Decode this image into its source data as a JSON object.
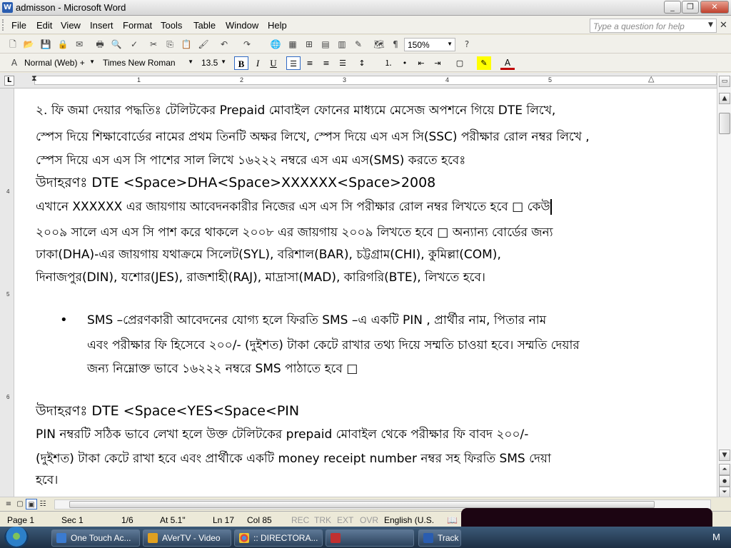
{
  "window": {
    "title": "admisson - Microsoft Word",
    "app_icon": "word-icon"
  },
  "menu": {
    "items": [
      "File",
      "Edit",
      "View",
      "Insert",
      "Format",
      "Tools",
      "Table",
      "Window",
      "Help"
    ],
    "help_placeholder": "Type a question for help"
  },
  "toolbar": {
    "zoom": "150%"
  },
  "formatting": {
    "style": "Normal (Web) +",
    "font": "Times New Roman",
    "size": "13.5",
    "bold": "B",
    "italic": "I",
    "underline": "U"
  },
  "ruler": {
    "marks": [
      "1",
      "2",
      "3",
      "4",
      "5"
    ]
  },
  "document": {
    "lines": [
      "২. ফি জমা দেয়ার পদ্ধতিঃ টেলিটকের Prepaid মোবাইল ফোনের মাধ্যমে মেসেজ অপশনে গিয়ে DTE লিখে,",
      "স্পেস দিয়ে শিক্ষাবোর্ডের নামের প্রথম তিনটি অক্ষর লিখে, স্পেস দিয়ে এস এস সি(SSC) পরীক্ষার রোল নম্বর লিখে ,",
      "স্পেস দিয়ে এস এস সি পাশের সাল লিখে ১৬২২২ নম্বরে এস এম এস(SMS) করতে হবেঃ",
      "উদাহরণঃ DTE <Space>DHA<Space>XXXXXX<Space>2008",
      "এখানে XXXXXX এর জায়গায় আবেদনকারীর নিজের এস এস সি পরীক্ষার রোল নম্বর লিখতে হবে □ কেউ",
      "২০০৯ সালে এস এস সি পাশ করে থাকলে ২০০৮ এর জায়গায় ২০০৯ লিখতে হবে □ অন্যান্য বোর্ডের জন্য",
      " ঢাকা(DHA)-এর জায়গায় যথাক্রমে সিলেট(SYL), বরিশাল(BAR), চট্টগ্রাম(CHI), কুমিল্লা(COM),",
      "দিনাজপুর(DIN), যশোর(JES), রাজশাহী(RAJ), মাদ্রাসা(MAD), কারিগরি(BTE), লিখতে হবে।",
      "SMS –প্রেরণকারী আবেদনের যোগ্য হলে ফিরতি SMS –এ একটি PIN , প্রার্থীর নাম, পিতার নাম",
      "এবং পরীক্ষার ফি হিসেবে ২০০/- (দুইশত) টাকা কেটে রাখার তথ্য দিয়ে সম্মতি চাওয়া হবে। সম্মতি দেয়ার",
      "জন্য নিম্নোক্ত ভাবে ১৬২২২ নম্বরে SMS পাঠাতে হবে □",
      "উদাহরণঃ DTE <Space<YES<Space<PIN",
      "PIN    নম্বরটি সঠিক ভাবে লেখা হলে উক্ত টেলিটকের prepaid মোবাইল থেকে পরীক্ষার ফি বাবদ ২০০/-",
      "(দুইশত) টাকা কেটে রাখা হবে এবং প্রার্থীকে একটি money receipt number নম্বর সহ ফিরতি SMS দেয়া",
      "হবে।"
    ]
  },
  "status": {
    "page": "Page 1",
    "sec": "Sec 1",
    "pages": "1/6",
    "at": "At 5.1\"",
    "ln": "Ln 17",
    "col": "Col 85",
    "rec": "REC",
    "trk": "TRK",
    "ext": "EXT",
    "ovr": "OVR",
    "lang": "English (U.S."
  },
  "taskbar": {
    "items": [
      "One Touch Ac...",
      "AVerTV - Video",
      ":: DIRECTORA...",
      "",
      "Track"
    ],
    "tray_text": "M"
  }
}
